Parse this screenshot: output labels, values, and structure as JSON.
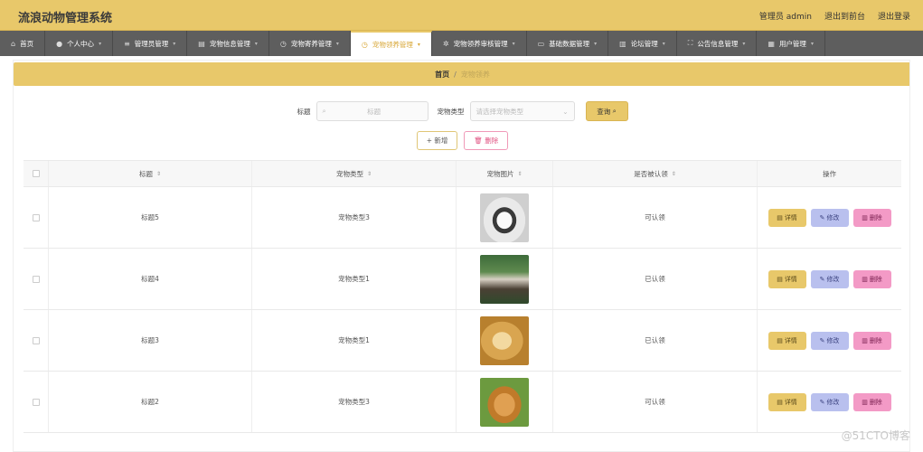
{
  "header": {
    "title": "流浪动物管理系统",
    "admin": "管理员 admin",
    "to_front": "退出到前台",
    "logout": "退出登录"
  },
  "nav": {
    "items": [
      {
        "label": "首页",
        "icon": "home-icon"
      },
      {
        "label": "个人中心",
        "icon": "user-icon"
      },
      {
        "label": "管理员管理",
        "icon": "sliders-icon"
      },
      {
        "label": "宠物信息管理",
        "icon": "clipboard-icon"
      },
      {
        "label": "宠物寄养管理",
        "icon": "clock-icon"
      },
      {
        "label": "宠物领养管理",
        "icon": "clock-icon"
      },
      {
        "label": "宠物领养审核管理",
        "icon": "settings-icon"
      },
      {
        "label": "基础数据管理",
        "icon": "chat-icon"
      },
      {
        "label": "论坛管理",
        "icon": "chart-icon"
      },
      {
        "label": "公告信息管理",
        "icon": "frame-icon"
      },
      {
        "label": "用户管理",
        "icon": "list-icon"
      }
    ],
    "active_index": 5
  },
  "breadcrumb": {
    "home": "首页",
    "separator": "/",
    "current": "宠物领养"
  },
  "search": {
    "title_label": "标题",
    "title_placeholder": "标题",
    "type_label": "宠物类型",
    "type_placeholder": "请选择宠物类型",
    "query_button": "查询"
  },
  "actions": {
    "add": "新增",
    "delete": "删除"
  },
  "table": {
    "columns": [
      "标题",
      "宠物类型",
      "宠物图片",
      "是否被认领",
      "操作"
    ],
    "rows": [
      {
        "title": "标题5",
        "type": "宠物类型3",
        "status": "可认领",
        "image": "husky-puppy"
      },
      {
        "title": "标题4",
        "type": "宠物类型1",
        "status": "已认领",
        "image": "husky-outdoor"
      },
      {
        "title": "标题3",
        "type": "宠物类型1",
        "status": "已认领",
        "image": "golden-retriever"
      },
      {
        "title": "标题2",
        "type": "宠物类型3",
        "status": "可认领",
        "image": "golden-on-grass"
      }
    ],
    "ops": {
      "detail": "详情",
      "edit": "修改",
      "remove": "删除"
    }
  },
  "watermark": "@51CTO博客",
  "colors": {
    "accent": "#e8c86a",
    "nav_bg": "#5e5e5e",
    "edit": "#b9c0ee",
    "remove": "#f39ac6"
  }
}
